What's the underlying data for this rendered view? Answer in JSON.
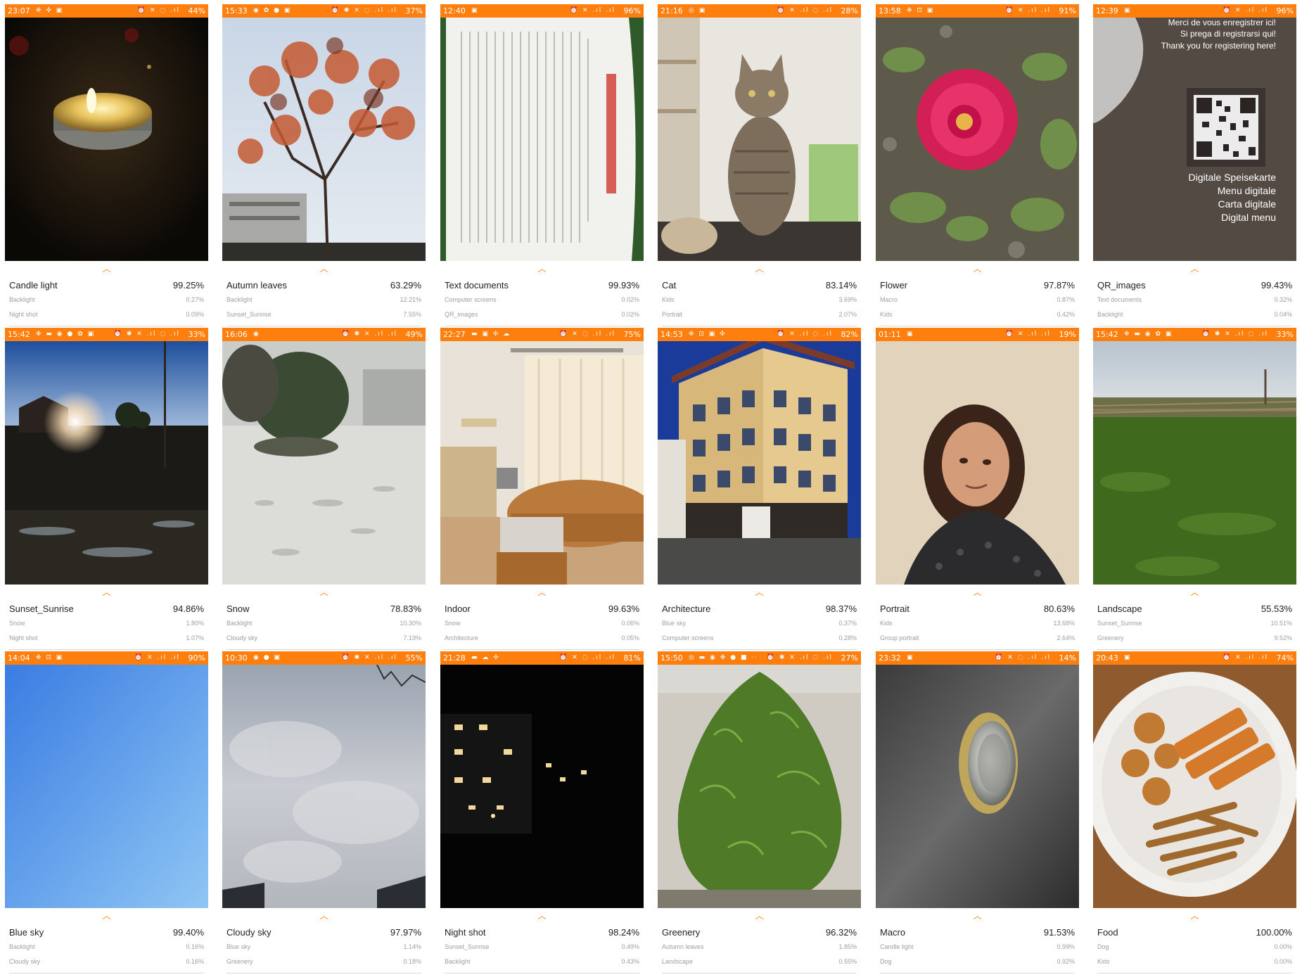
{
  "screens": [
    {
      "status": {
        "time": "23:07",
        "left_icons": "❉ ✣ ▣",
        "right_icons": "⏰ ✕ ◌ .ıl",
        "battery": "44%"
      },
      "top": {
        "label": "Candle light",
        "value": "99.25%"
      },
      "second": {
        "label": "Backlight",
        "value": "0.27%"
      },
      "third": {
        "label": "Night shot",
        "value": "0.09%"
      },
      "photo_subject": "candle-photo"
    },
    {
      "status": {
        "time": "15:33",
        "left_icons": "◉ ✿ ● ▣",
        "right_icons": "⏰ ✱ ✕ ◌ .ıl .ıl",
        "battery": "37%"
      },
      "top": {
        "label": "Autumn leaves",
        "value": "63.29%"
      },
      "second": {
        "label": "Backlight",
        "value": "12.21%"
      },
      "third": {
        "label": "Sunset_Sunrise",
        "value": "7.55%"
      },
      "photo_subject": "autumn-tree-photo"
    },
    {
      "status": {
        "time": "12:40",
        "left_icons": "▣",
        "right_icons": "⏰ ✕ .ıl .ıl",
        "battery": "96%"
      },
      "top": {
        "label": "Text documents",
        "value": "99.93%"
      },
      "second": {
        "label": "Computer screens",
        "value": "0.02%"
      },
      "third": {
        "label": "QR_images",
        "value": "0.02%"
      },
      "photo_subject": "document-photo"
    },
    {
      "status": {
        "time": "21:16",
        "left_icons": "◎ ▣",
        "right_icons": "⏰ ✕ .ıl ◌ .ıl",
        "battery": "28%"
      },
      "top": {
        "label": "Cat",
        "value": "83.14%"
      },
      "second": {
        "label": "Kids",
        "value": "3.69%"
      },
      "third": {
        "label": "Portrait",
        "value": "2.07%"
      },
      "photo_subject": "cat-photo"
    },
    {
      "status": {
        "time": "13:58",
        "left_icons": "❉ ⊡ ▣",
        "right_icons": "⏰ ✕ .ıl .ıl",
        "battery": "91%"
      },
      "top": {
        "label": "Flower",
        "value": "97.87%"
      },
      "second": {
        "label": "Macro",
        "value": "0.87%"
      },
      "third": {
        "label": "Kids",
        "value": "0.42%"
      },
      "photo_subject": "flower-photo"
    },
    {
      "status": {
        "time": "12:39",
        "left_icons": "▣",
        "right_icons": "⏰ ✕ .ıl .ıl",
        "battery": "96%"
      },
      "top": {
        "label": "QR_images",
        "value": "99.43%"
      },
      "second": {
        "label": "Text documents",
        "value": "0.32%"
      },
      "third": {
        "label": "Backlight",
        "value": "0.04%"
      },
      "photo_subject": "qr-photo",
      "photo_text": {
        "line1": "Merci de vous enregistrer ici!",
        "line2": "Si prega di registrarsi qui!",
        "line3": "Thank you for registering here!",
        "line4": "Digitale Speisekarte",
        "line5": "Menu digitale",
        "line6": "Carta digitale",
        "line7": "Digital menu"
      }
    },
    {
      "status": {
        "time": "15:42",
        "left_icons": "❉ ▬ ◉ ● ✿ ▣",
        "right_icons": "⏰ ✱ ✕ .ıl ◌ .ıl",
        "battery": "33%"
      },
      "top": {
        "label": "Sunset_Sunrise",
        "value": "94.86%"
      },
      "second": {
        "label": "Snow",
        "value": "1.80%"
      },
      "third": {
        "label": "Night shot",
        "value": "1.07%"
      },
      "photo_subject": "sunset-photo"
    },
    {
      "status": {
        "time": "16:06",
        "left_icons": "◉",
        "right_icons": "⏰ ✱ ✕ .ıl .ıl",
        "battery": "49%"
      },
      "top": {
        "label": "Snow",
        "value": "78.83%"
      },
      "second": {
        "label": "Backlight",
        "value": "10.30%"
      },
      "third": {
        "label": "Cloudy sky",
        "value": "7.19%"
      },
      "photo_subject": "snow-photo"
    },
    {
      "status": {
        "time": "22:27",
        "left_icons": "▬ ▣ ✣ ☁",
        "right_icons": "⏰ ✕ ◌ .ıl .ıl",
        "battery": "75%"
      },
      "top": {
        "label": "Indoor",
        "value": "99.63%"
      },
      "second": {
        "label": "Snow",
        "value": "0.06%"
      },
      "third": {
        "label": "Architecture",
        "value": "0.05%"
      },
      "photo_subject": "indoor-photo"
    },
    {
      "status": {
        "time": "14:53",
        "left_icons": "❉ ⊡ ▣ ✣",
        "right_icons": "⏰ ✕ .ıl ◌ .ıl",
        "battery": "82%"
      },
      "top": {
        "label": "Architecture",
        "value": "98.37%"
      },
      "second": {
        "label": "Blue sky",
        "value": "0.37%"
      },
      "third": {
        "label": "Computer screens",
        "value": "0.28%"
      },
      "photo_subject": "building-photo"
    },
    {
      "status": {
        "time": "01:11",
        "left_icons": "▣",
        "right_icons": "⏰ ✕ .ıl .ıl",
        "battery": "19%"
      },
      "top": {
        "label": "Portrait",
        "value": "80.63%"
      },
      "second": {
        "label": "Kids",
        "value": "13.68%"
      },
      "third": {
        "label": "Group portrait",
        "value": "2.64%"
      },
      "photo_subject": "portrait-photo"
    },
    {
      "status": {
        "time": "15:42",
        "left_icons": "❉ ▬ ◉ ✿ ▣",
        "right_icons": "⏰ ✱ ✕ .ıl ◌ .ıl",
        "battery": "33%"
      },
      "top": {
        "label": "Landscape",
        "value": "55.53%"
      },
      "second": {
        "label": "Sunset_Sunrise",
        "value": "10.51%"
      },
      "third": {
        "label": "Greenery",
        "value": "9.52%"
      },
      "photo_subject": "landscape-photo"
    },
    {
      "status": {
        "time": "14:04",
        "left_icons": "❉ ⊡ ▣",
        "right_icons": "⏰ ✕ .ıl .ıl",
        "battery": "90%"
      },
      "top": {
        "label": "Blue sky",
        "value": "99.40%"
      },
      "second": {
        "label": "Backlight",
        "value": "0.16%"
      },
      "third": {
        "label": "Cloudy sky",
        "value": "0.16%"
      },
      "photo_subject": "blue-sky-photo"
    },
    {
      "status": {
        "time": "10:30",
        "left_icons": "◉ ● ▣",
        "right_icons": "⏰ ✱ ✕ .ıl .ıl",
        "battery": "55%"
      },
      "top": {
        "label": "Cloudy sky",
        "value": "97.97%"
      },
      "second": {
        "label": "Blue sky",
        "value": "1.14%"
      },
      "third": {
        "label": "Greenery",
        "value": "0.18%"
      },
      "photo_subject": "cloudy-sky-photo"
    },
    {
      "status": {
        "time": "21:28",
        "left_icons": "▬ ☁ ✣",
        "right_icons": "⏰ ✕ ◌ .ıl .ıl",
        "battery": "81%"
      },
      "top": {
        "label": "Night shot",
        "value": "98.24%"
      },
      "second": {
        "label": "Sunset_Sunrise",
        "value": "0.49%"
      },
      "third": {
        "label": "Backlight",
        "value": "0.43%"
      },
      "photo_subject": "night-photo"
    },
    {
      "status": {
        "time": "15:50",
        "left_icons": "◎ ▬ ◉ ❉ ● ■ ··",
        "right_icons": "⏰ ✱ ✕ .ıl ◌ .ıl",
        "battery": "27%"
      },
      "top": {
        "label": "Greenery",
        "value": "96.32%"
      },
      "second": {
        "label": "Autumn leaves",
        "value": "1.85%"
      },
      "third": {
        "label": "Landscape",
        "value": "0.55%"
      },
      "photo_subject": "bush-photo"
    },
    {
      "status": {
        "time": "23:32",
        "left_icons": "▣",
        "right_icons": "⏰ ✕ ◌ .ıl .ıl",
        "battery": "14%"
      },
      "top": {
        "label": "Macro",
        "value": "91.53%"
      },
      "second": {
        "label": "Candle light",
        "value": "0.99%"
      },
      "third": {
        "label": "Dog",
        "value": "0.92%"
      },
      "photo_subject": "coin-photo"
    },
    {
      "status": {
        "time": "20:43",
        "left_icons": "▣",
        "right_icons": "⏰ ✕ .ıl .ıl",
        "battery": "74%"
      },
      "top": {
        "label": "Food",
        "value": "100.00%"
      },
      "second": {
        "label": "Dog",
        "value": "0.00%"
      },
      "third": {
        "label": "Kids",
        "value": "0.00%"
      },
      "photo_subject": "food-photo"
    }
  ],
  "colors": {
    "accent": "#ff7f0e",
    "primary_text": "#222222",
    "secondary_text": "#9e9e9e"
  },
  "chevron_icon": "chevron-up-icon"
}
